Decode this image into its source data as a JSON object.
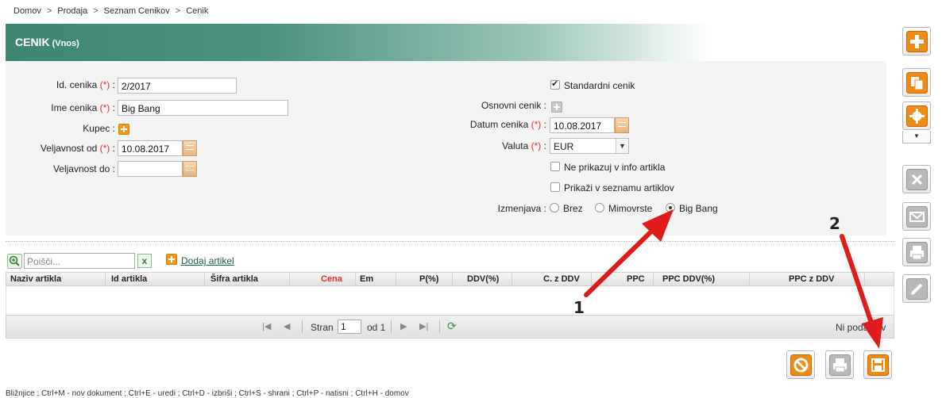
{
  "breadcrumb": [
    "Domov",
    "Prodaja",
    "Seznam Cenikov",
    "Cenik"
  ],
  "header": {
    "title": "CENIK",
    "subtitle": "(Vnos)"
  },
  "form": {
    "left": {
      "id_label": "Id. cenika",
      "id_value": "2/2017",
      "name_label": "Ime cenika",
      "name_value": "Big Bang",
      "buyer_label": "Kupec :",
      "valid_from_label": "Veljavnost od",
      "valid_from_value": "10.08.2017",
      "valid_to_label": "Veljavnost do :",
      "valid_to_value": ""
    },
    "right": {
      "standard_label": "Standardni cenik",
      "standard_checked": true,
      "base_label": "Osnovni cenik :",
      "date_label": "Datum cenika",
      "date_value": "10.08.2017",
      "currency_label": "Valuta",
      "currency_value": "EUR",
      "no_info_label": "Ne prikazuj v info artikla",
      "show_list_label": "Prikaži v seznamu artiklov",
      "exchange_label": "Izmenjava :",
      "exchange_options": [
        "Brez",
        "Mimovrste",
        "Big Bang"
      ],
      "exchange_selected": "Big Bang"
    },
    "required_mark": "(*)",
    "colon": ":"
  },
  "grid": {
    "search_placeholder": "Poišči...",
    "clear_label": "x",
    "add_article_label": "Dodaj artikel",
    "columns": [
      "Naziv artikla",
      "Id artikla",
      "Šifra artikla",
      "Cena",
      "Em",
      "P(%)",
      "DDV(%)",
      "C. z DDV",
      "PPC",
      "PPC DDV(%)",
      "PPC z DDV"
    ],
    "pager": {
      "page_label": "Stran",
      "page_value": "1",
      "of_label": "od 1",
      "no_data": "Ni podatkov"
    }
  },
  "annotations": {
    "one": "1",
    "two": "2"
  },
  "footer": "Bližnjice : Ctrl+M - nov dokument ; Ctrl+E - uredi ; Ctrl+D - izbriši ; Ctrl+S - shrani ; Ctrl+P - natisni ; Ctrl+H - domov",
  "colors": {
    "accent": "#3d8672",
    "orange": "#ea7a06",
    "required": "#d9302c",
    "arrow": "#e01b1b"
  }
}
